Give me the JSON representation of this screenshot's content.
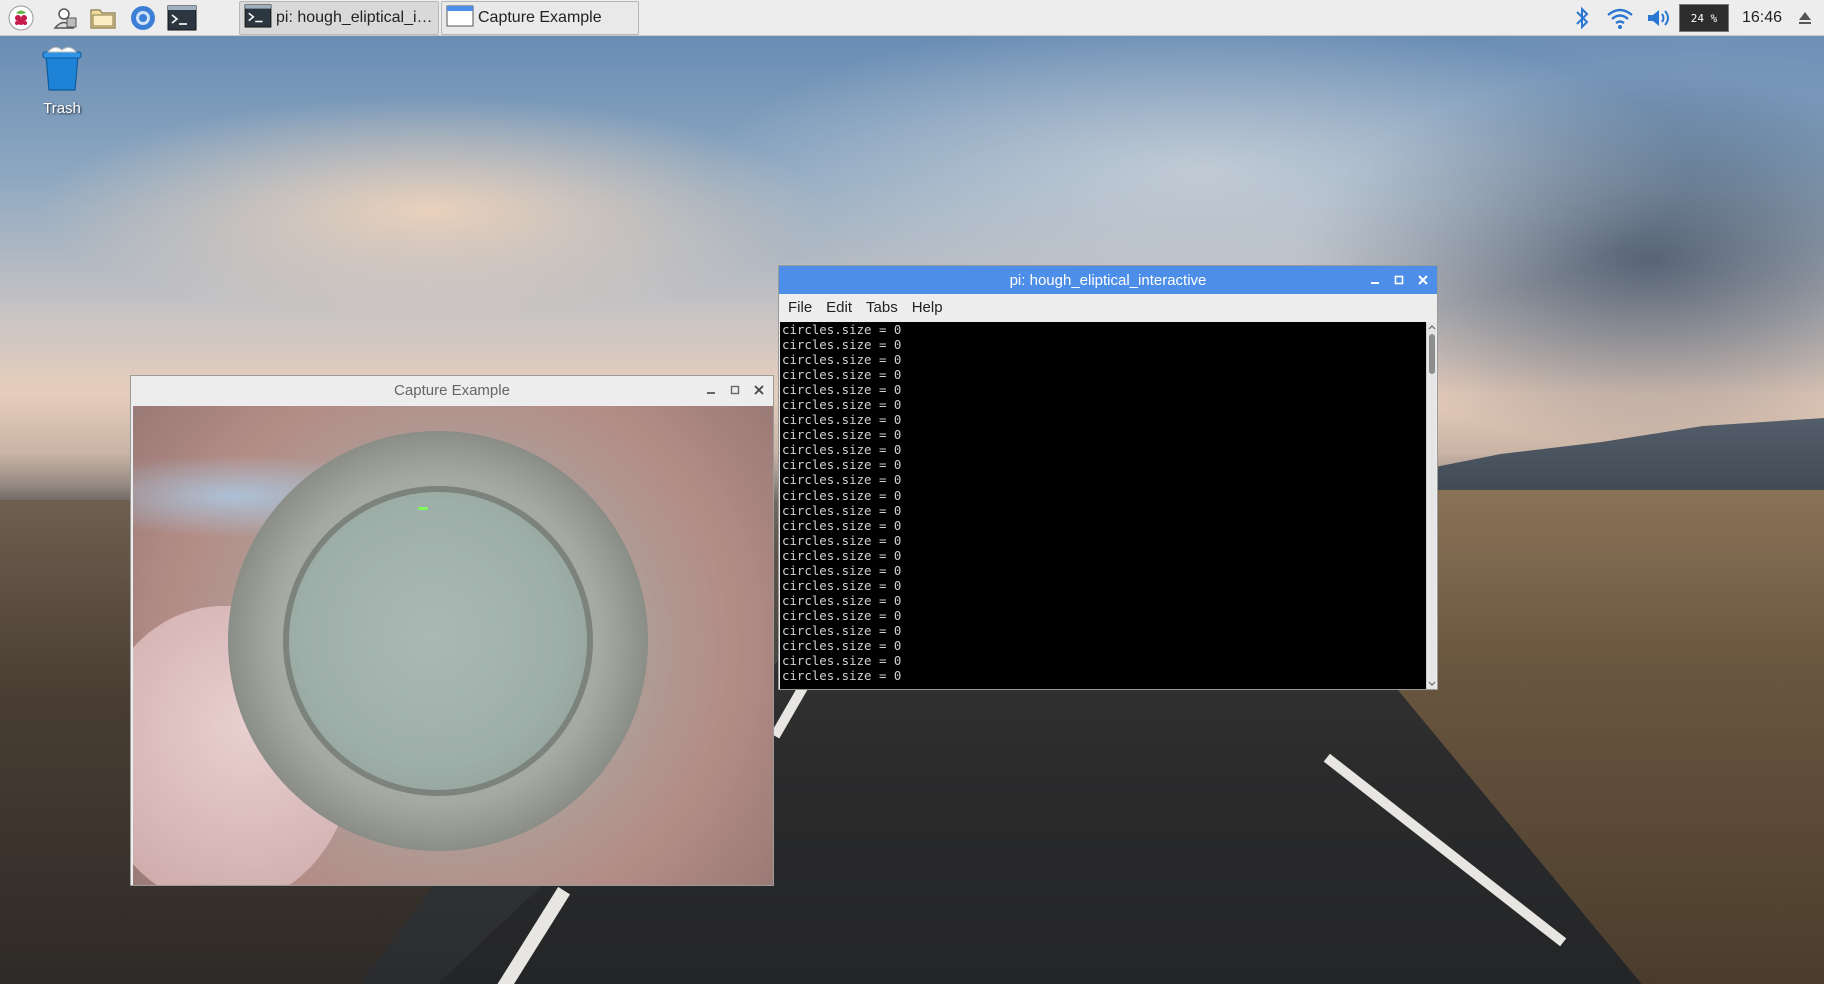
{
  "taskbar": {
    "launchers": [
      {
        "name": "raspberry-menu-icon"
      },
      {
        "name": "user-icon"
      },
      {
        "name": "file-manager-icon"
      },
      {
        "name": "browser-icon"
      },
      {
        "name": "terminal-icon"
      }
    ],
    "tasks": [
      {
        "label": "pi: hough_eliptical_int...",
        "icon": "terminal-icon"
      },
      {
        "label": "Capture Example",
        "icon": "window-icon"
      }
    ],
    "tray": {
      "cpu_label": "24 %",
      "clock": "16:46"
    }
  },
  "desktop": {
    "trash_label": "Trash"
  },
  "capture_window": {
    "title": "Capture Example"
  },
  "terminal_window": {
    "title": "pi: hough_eliptical_interactive",
    "menu": [
      "File",
      "Edit",
      "Tabs",
      "Help"
    ],
    "lines": [
      "circles.size = 0",
      "circles.size = 0",
      "circles.size = 0",
      "circles.size = 0",
      "circles.size = 0",
      "circles.size = 0",
      "circles.size = 0",
      "circles.size = 0",
      "circles.size = 0",
      "circles.size = 0",
      "circles.size = 0",
      "circles.size = 0",
      "circles.size = 0",
      "circles.size = 0",
      "circles.size = 0",
      "circles.size = 0",
      "circles.size = 0",
      "circles.size = 0",
      "circles.size = 0",
      "circles.size = 0",
      "circles.size = 0",
      "circles.size = 0",
      "circles.size = 0",
      "circles.size = 0"
    ]
  },
  "colors": {
    "active_title": "#4d8fe8",
    "terminal_bg": "#000000",
    "terminal_fg": "#d2d2d2",
    "glint": "#7dff5a"
  }
}
